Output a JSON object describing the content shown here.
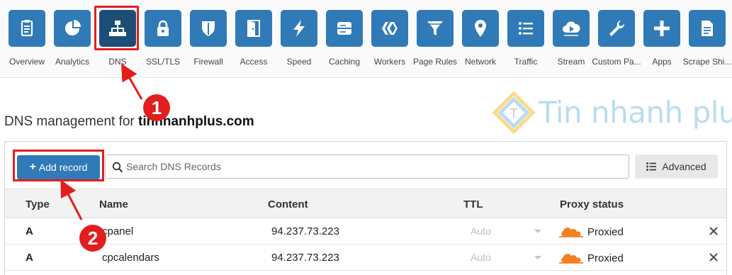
{
  "nav": {
    "items": [
      {
        "label": "Overview",
        "icon": "overview-icon"
      },
      {
        "label": "Analytics",
        "icon": "analytics-icon"
      },
      {
        "label": "DNS",
        "icon": "dns-icon",
        "active": true
      },
      {
        "label": "SSL/TLS",
        "icon": "lock-icon"
      },
      {
        "label": "Firewall",
        "icon": "shield-icon"
      },
      {
        "label": "Access",
        "icon": "door-icon"
      },
      {
        "label": "Speed",
        "icon": "lightning-icon"
      },
      {
        "label": "Caching",
        "icon": "server-icon"
      },
      {
        "label": "Workers",
        "icon": "workers-icon"
      },
      {
        "label": "Page Rules",
        "icon": "funnel-icon"
      },
      {
        "label": "Network",
        "icon": "map-pin-icon"
      },
      {
        "label": "Traffic",
        "icon": "list-icon"
      },
      {
        "label": "Stream",
        "icon": "cloud-play-icon"
      },
      {
        "label": "Custom Pa...",
        "icon": "wrench-icon"
      },
      {
        "label": "Apps",
        "icon": "plus-icon"
      },
      {
        "label": "Scrape Shi...",
        "icon": "document-icon"
      }
    ]
  },
  "watermark": {
    "text": "Tin nhanh plus"
  },
  "heading": {
    "prefix": "DNS management for ",
    "domain": "tinnhanhplus.com"
  },
  "toolbar": {
    "add_label": "Add record",
    "search_placeholder": "Search DNS Records",
    "advanced_label": "Advanced"
  },
  "table": {
    "headers": {
      "type": "Type",
      "name": "Name",
      "content": "Content",
      "ttl": "TTL",
      "proxy": "Proxy status"
    },
    "rows": [
      {
        "type": "A",
        "name": "cpanel",
        "content": "94.237.73.223",
        "ttl": "Auto",
        "proxy": "Proxied"
      },
      {
        "type": "A",
        "name": "cpcalendars",
        "content": "94.237.73.223",
        "ttl": "Auto",
        "proxy": "Proxied"
      }
    ]
  },
  "annotations": {
    "step1": "1",
    "step2": "2"
  },
  "colors": {
    "accent": "#2f7ab7",
    "active_nav": "#1d4e78",
    "highlight": "#e21e1e",
    "cloud": "#f38020"
  }
}
